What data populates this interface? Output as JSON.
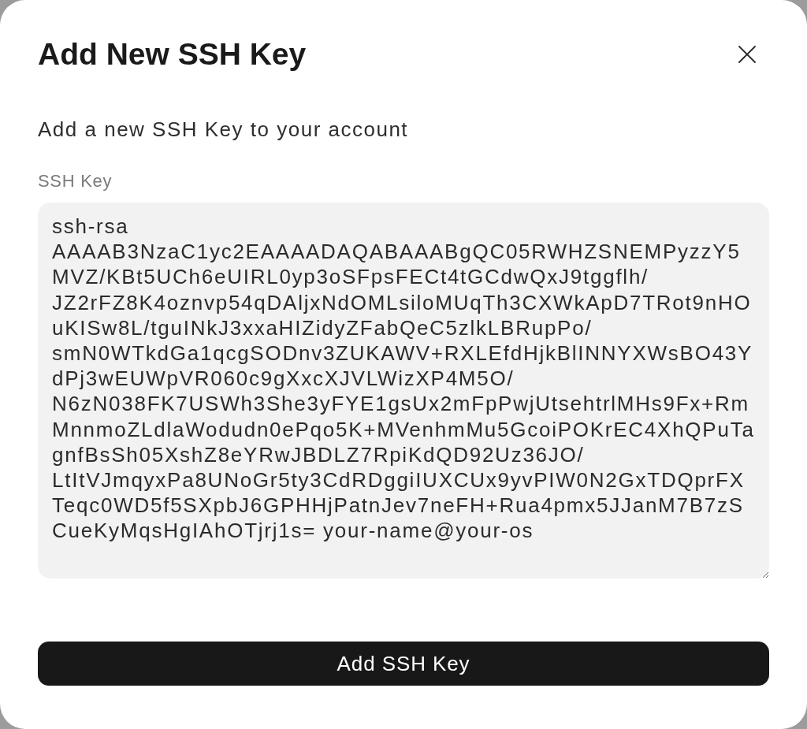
{
  "dialog": {
    "title": "Add New SSH Key",
    "description": "Add a new SSH Key to your account"
  },
  "field": {
    "label": "SSH Key",
    "value": "ssh-rsa AAAAB3NzaC1yc2EAAAADAQABAAABgQC05RWHZSNEMPyzzY5MVZ/KBt5UCh6eUIRL0yp3oSFpsFECt4tGCdwQxJ9tggflh/JZ2rFZ8K4oznvp54qDAljxNdOMLsiloMUqTh3CXWkApD7TRot9nHOuKISw8L/tguINkJ3xxaHIZidyZFabQeC5zlkLBRupPo/smN0WTkdGa1qcgSODnv3ZUKAWV+RXLEfdHjkBlINNYXWsBO43YdPj3wEUWpVR060c9gXxcXJVLWizXP4M5O/N6zN038FK7USWh3She3yFYE1gsUx2mFpPwjUtsehtrlMHs9Fx+RmMnnmoZLdlaWodudn0ePqo5K+MVenhmMu5GcoiPOKrEC4XhQPuTagnfBsSh05XshZ8eYRwJBDLZ7RpiKdQD92Uz36JO/LtItVJmqyxPa8UNoGr5ty3CdRDggiIUXCUx9yvPIW0N2GxTDQprFXTeqc0WD5f5SXpbJ6GPHHjPatnJev7neFH+Rua4pmx5JJanM7B7zSCueKyMqsHgIAhOTjrj1s= your-name@your-os"
  },
  "submit_button": {
    "label": "Add SSH Key"
  }
}
